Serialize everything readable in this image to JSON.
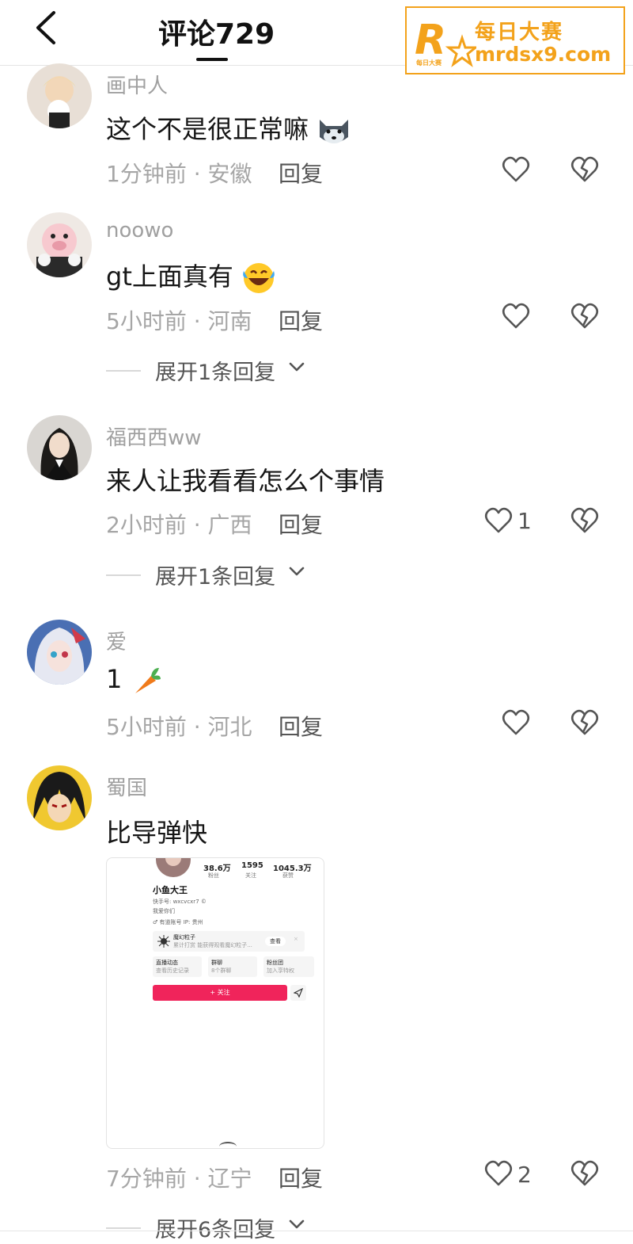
{
  "header": {
    "title": "评论729",
    "back_icon": "chevron-left-icon"
  },
  "watermark": {
    "line1": "每日大赛",
    "line2": "mrdsx9.com",
    "logo_letter": "R",
    "logo_small": "每日大赛",
    "color": "#f3a21b"
  },
  "comments": [
    {
      "username": "画中人",
      "text": "这个不是很正常嘛",
      "emoji": "husky-emoji",
      "time_location": "1分钟前 · 安徽",
      "reply": "回复",
      "likes": ""
    },
    {
      "username": "noowo",
      "text": "gt上面真有",
      "emoji": "laugh-cry-emoji",
      "time_location": "5小时前 · 河南",
      "reply": "回复",
      "likes": "",
      "expand": "展开1条回复"
    },
    {
      "username": "福西西ww",
      "text": "来人让我看看怎么个事情",
      "time_location": "2小时前 · 广西",
      "reply": "回复",
      "likes": "1",
      "expand": "展开1条回复"
    },
    {
      "username": "爱",
      "text": "1",
      "emoji": "carrot-emoji",
      "time_location": "5小时前 · 河北",
      "reply": "回复",
      "likes": ""
    },
    {
      "username": "蜀国",
      "text": "比导弹快",
      "time_location": "7分钟前 · 辽宁",
      "reply": "回复",
      "likes": "2",
      "expand": "展开6条回复"
    }
  ],
  "attachment": {
    "stats": [
      {
        "value": "38.6万",
        "label": "粉丝"
      },
      {
        "value": "1595",
        "label": "关注"
      },
      {
        "value": "1045.3万",
        "label": "获赞"
      }
    ],
    "name": "小鱼大王",
    "kuaishou_id": "快手号: wxcvcxr7 ©",
    "bio": "我爱你们",
    "tags": "♂ 有道账号    IP: 贵州",
    "card_title": "魔幻粒子",
    "card_sub": "累计打赏  能获得观看魔幻粒子...",
    "card_button": "查看",
    "cell1_title": "直播动态",
    "cell1_sub": "查看历史记录",
    "cell2_title": "群聊",
    "cell2_sub": "8个群聊",
    "cell3_title": "粉丝团",
    "cell3_sub": "加入享特权",
    "follow_button": "+ 关注"
  }
}
